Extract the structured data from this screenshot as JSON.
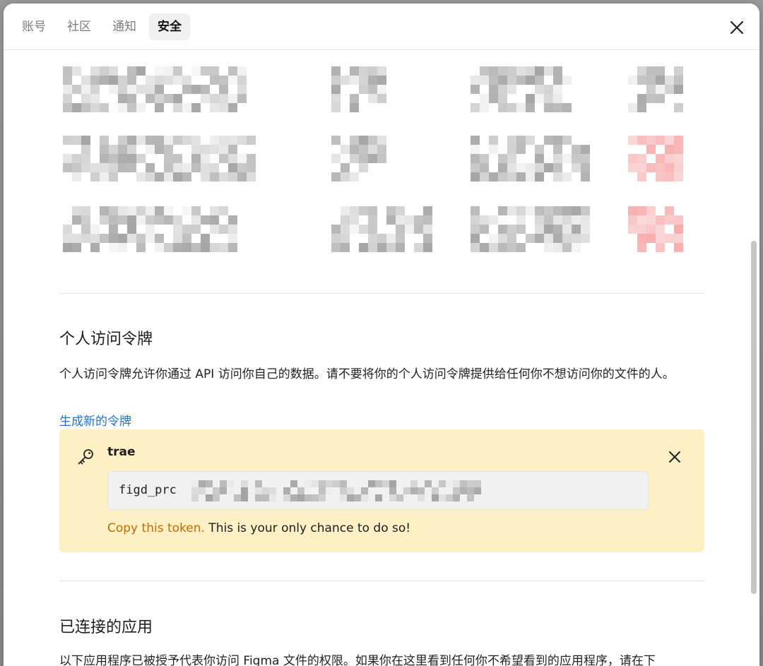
{
  "tabs": [
    {
      "label": "账号",
      "active": false
    },
    {
      "label": "社区",
      "active": false
    },
    {
      "label": "通知",
      "active": false
    },
    {
      "label": "安全",
      "active": true
    }
  ],
  "personal_tokens": {
    "title": "个人访问令牌",
    "description": "个人访问令牌允许你通过 API 访问你自己的数据。请不要将你的个人访问令牌提供给任何你不想访问你的文件的人。",
    "generate_link": "生成新的令牌",
    "token": {
      "name": "trae",
      "value_prefix": "figd_prc",
      "warning_highlight": "Copy this token.",
      "warning_rest": " This is your only chance to do so!"
    }
  },
  "connected_apps": {
    "title": "已连接的应用",
    "description": "以下应用程序已被授予代表你访问 Figma 文件的权限。如果你在这里看到任何你不希望看到的应用程序，请在下"
  },
  "colors": {
    "accent_link": "#1a73d9",
    "token_card_bg": "#fdf0c4",
    "warning_orange": "#c26b00"
  }
}
